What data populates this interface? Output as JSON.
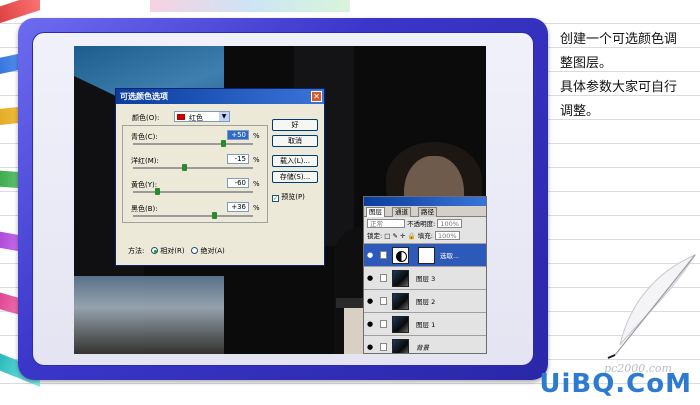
{
  "dialog": {
    "title": "可选颜色选项",
    "close_glyph": "✕",
    "colors_label": "颜色(O):",
    "colors_value": "红色",
    "rows": [
      {
        "label": "青色(C):",
        "value": "+50",
        "pct": "%",
        "level": 0.75
      },
      {
        "label": "洋红(M):",
        "value": "-15",
        "pct": "%",
        "level": 0.425
      },
      {
        "label": "黄色(Y):",
        "value": "-60",
        "pct": "%",
        "level": 0.2
      },
      {
        "label": "黑色(B):",
        "value": "+36",
        "pct": "%",
        "level": 0.68
      }
    ],
    "buttons": {
      "ok": "好",
      "cancel": "取消",
      "load": "载入(L)...",
      "save": "存储(S)..."
    },
    "preview": "预览(P)",
    "method_label": "方法:",
    "method_relative": "相对(R)",
    "method_absolute": "绝对(A)"
  },
  "layers_panel": {
    "tabs": [
      "图层",
      "通道",
      "路径"
    ],
    "blend_mode": "正常",
    "opacity_label": "不透明度:",
    "opacity_value": "100%",
    "lock_label": "锁定:",
    "fill_label": "填充:",
    "fill_value": "100%",
    "layers": [
      {
        "name": "选取...",
        "active": true
      },
      {
        "name": "图层 3",
        "active": false
      },
      {
        "name": "图层 2",
        "active": false
      },
      {
        "name": "图层 1",
        "active": false
      },
      {
        "name": "背景",
        "active": false
      }
    ]
  },
  "side_text": {
    "line1": "创建一个可选颜色调",
    "line2": "整图层。",
    "line3": "具体参数大家可自行",
    "line4": "调整。"
  },
  "watermark": {
    "text": "UiBQ.CoM",
    "faint": "pc2000.com"
  },
  "colors": {
    "frame": "#3a36c9",
    "titlebar": "#0a3d9e",
    "watermark": "#2c7bd1"
  }
}
